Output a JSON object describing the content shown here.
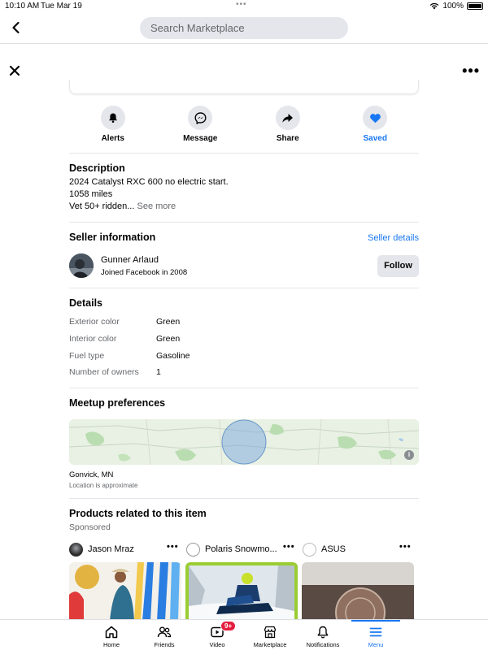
{
  "status_bar": {
    "time": "10:10 AM",
    "date": "Tue Mar 19",
    "battery": "100%"
  },
  "search": {
    "placeholder": "Search Marketplace"
  },
  "actions": [
    {
      "label": "Alerts",
      "icon": "bell-icon"
    },
    {
      "label": "Message",
      "icon": "messenger-icon"
    },
    {
      "label": "Share",
      "icon": "share-icon"
    },
    {
      "label": "Saved",
      "icon": "heart-icon",
      "active_color": "#1877f2"
    }
  ],
  "description": {
    "title": "Description",
    "line1": "2024 Catalyst RXC 600 no electric start.",
    "line2": "1058 miles",
    "line3": "Vet 50+ ridden...",
    "see_more": "See more"
  },
  "seller": {
    "title": "Seller information",
    "details_link": "Seller details",
    "name": "Gunner Arlaud",
    "joined": "Joined Facebook in 2008",
    "follow_label": "Follow"
  },
  "details": {
    "title": "Details",
    "rows": [
      {
        "key": "Exterior color",
        "value": "Green"
      },
      {
        "key": "Interior color",
        "value": "Green"
      },
      {
        "key": "Fuel type",
        "value": "Gasoline"
      },
      {
        "key": "Number of owners",
        "value": "1"
      }
    ]
  },
  "meetup": {
    "title": "Meetup preferences",
    "location": "Gonvick, MN",
    "note": "Location is approximate"
  },
  "related": {
    "title": "Products related to this item",
    "sponsored": "Sponsored",
    "ads": [
      {
        "name": "Jason Mraz"
      },
      {
        "name": "Polaris Snowmo..."
      },
      {
        "name": "ASUS"
      }
    ]
  },
  "tabs": [
    {
      "label": "Home"
    },
    {
      "label": "Friends"
    },
    {
      "label": "Video",
      "badge": "9+"
    },
    {
      "label": "Marketplace"
    },
    {
      "label": "Notifications"
    },
    {
      "label": "Menu"
    }
  ],
  "colors": {
    "accent": "#1877f2",
    "badge": "#e41e3f",
    "secondary_text": "#65676b"
  }
}
